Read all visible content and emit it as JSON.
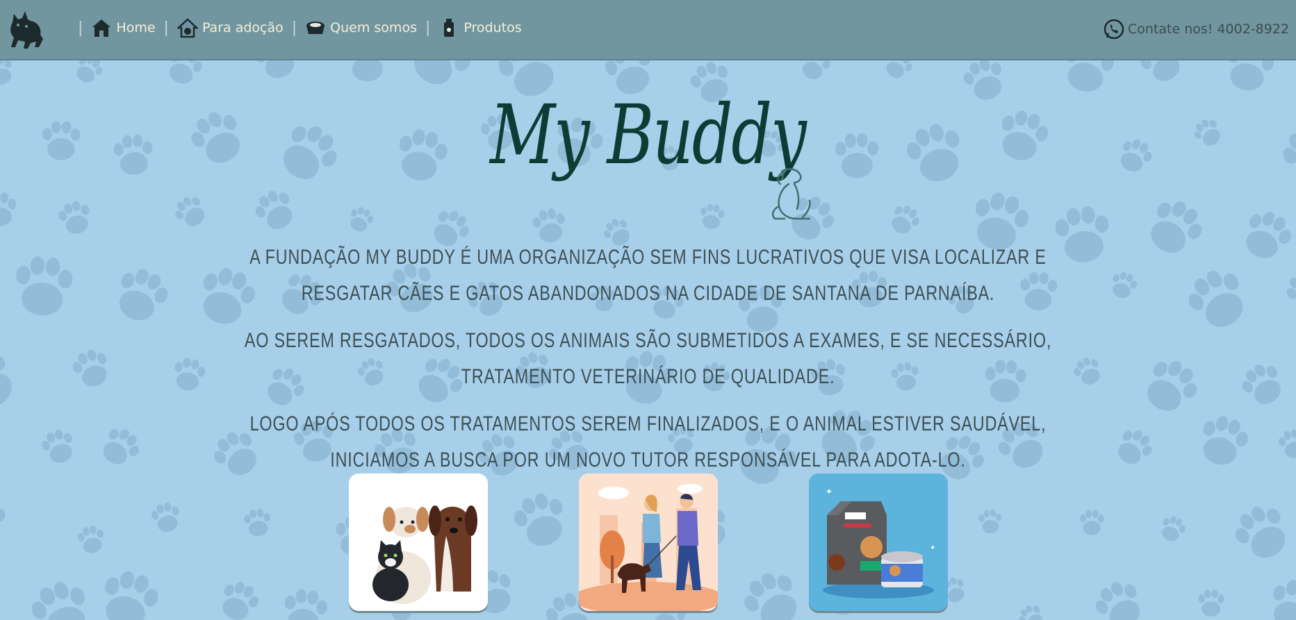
{
  "nav": {
    "logo": "cat-and-dog-logo",
    "items": [
      {
        "label": "Home",
        "icon": "home-icon"
      },
      {
        "label": "Para adoção",
        "icon": "adoption-house-icon"
      },
      {
        "label": "Quem somos",
        "icon": "pet-bowl-icon"
      },
      {
        "label": "Produtos",
        "icon": "product-bottle-icon"
      }
    ],
    "contact": {
      "label": "Contate nos! 4002-8922",
      "icon": "whatsapp-icon"
    }
  },
  "hero": {
    "brand_title": "My Buddy",
    "brand_icon": "sitting-dog-icon",
    "paragraphs": [
      "A Fundação My Buddy é uma organização sem fins lucrativos que visa localizar e resgatar cães e gatos abandonados na cidade de Santana de Parnaíba.",
      "Ao serem resgatados, todos os animais são submetidos a exames, e se necessário, tratamento veterinário de qualidade.",
      "Logo após todos os tratamentos serem finalizados, e o animal estiver saudável, iniciamos a busca por um novo tutor responsável para adota-lo."
    ]
  },
  "cards": [
    {
      "name": "card-pets",
      "image": "dogs-and-cat-illustration"
    },
    {
      "name": "card-walk",
      "image": "couple-walking-dog-illustration"
    },
    {
      "name": "card-products",
      "image": "dog-food-products-illustration"
    }
  ],
  "colors": {
    "background": "#a8cfe9",
    "navbar": "#72969f",
    "nav_text": "#f4efd8",
    "brand": "#0e3c35",
    "paw": "#6f9ab5"
  }
}
